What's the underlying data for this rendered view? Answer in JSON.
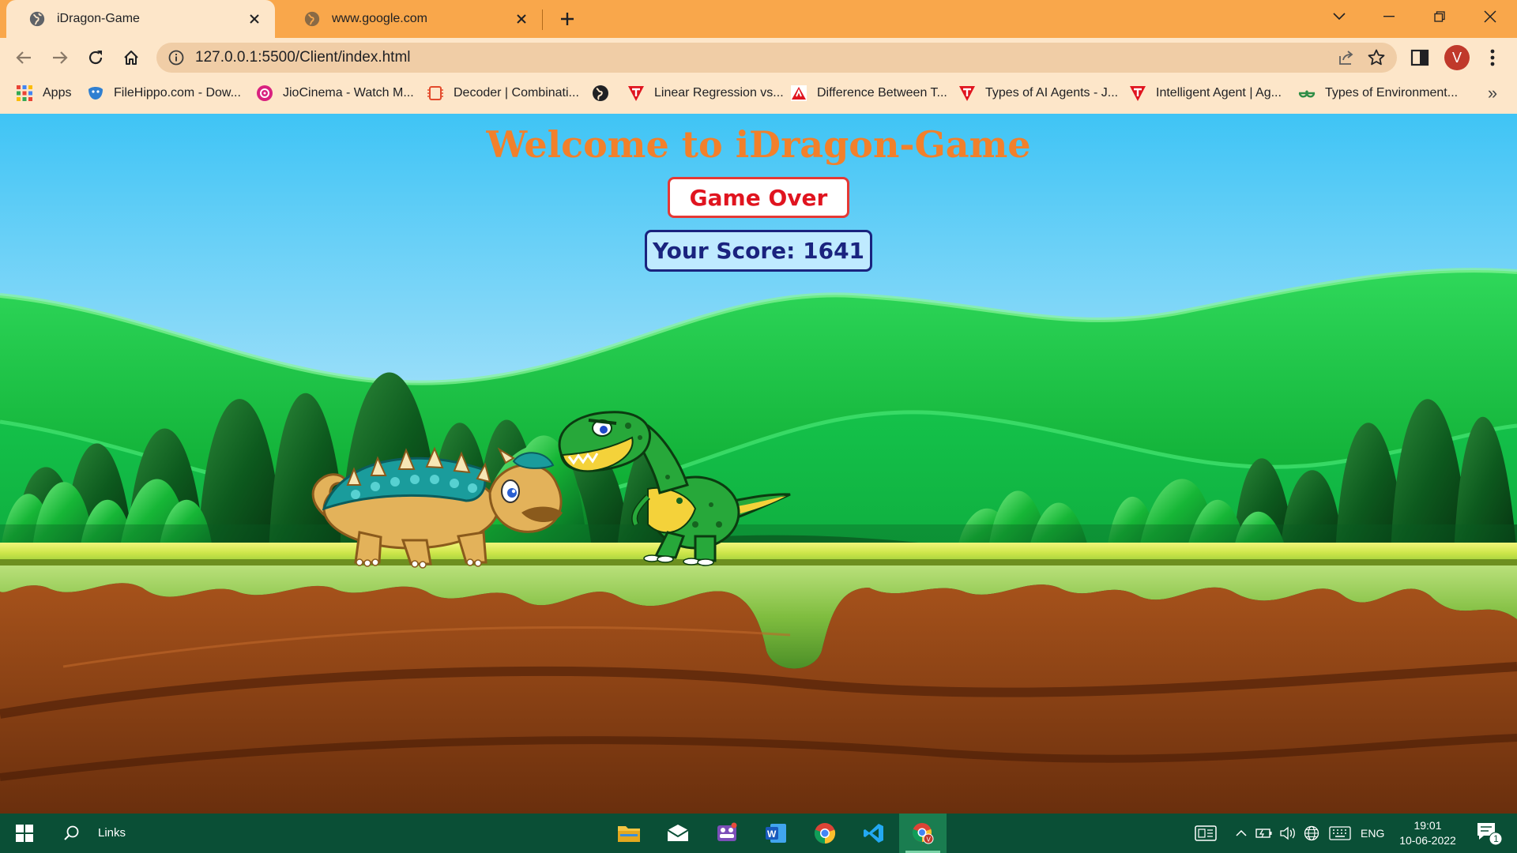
{
  "browser": {
    "tabs": [
      {
        "title": "iDragon-Game",
        "active": true
      },
      {
        "title": "www.google.com",
        "active": false
      }
    ],
    "url": "127.0.0.1:5500/Client/index.html",
    "profile_initial": "V",
    "colors": {
      "frame": "#f9a74b",
      "toolbar": "#fde6c9",
      "omnibox": "#f0cda6"
    }
  },
  "bookmarks": [
    {
      "label": "Apps",
      "icon": "apps-grid-icon"
    },
    {
      "label": "FileHippo.com - Dow...",
      "icon": "filehippo-icon"
    },
    {
      "label": "JioCinema - Watch M...",
      "icon": "jiocinema-icon"
    },
    {
      "label": "Decoder | Combinati...",
      "icon": "decoder-icon"
    },
    {
      "label": "",
      "icon": "globe-icon"
    },
    {
      "label": "Linear Regression vs...",
      "icon": "tutorial-red-icon"
    },
    {
      "label": "Difference Between T...",
      "icon": "alert-red-icon"
    },
    {
      "label": "Types of AI Agents - J...",
      "icon": "tutorial-red-icon"
    },
    {
      "label": "Intelligent Agent | Ag...",
      "icon": "tutorial-red-icon"
    },
    {
      "label": "Types of Environment...",
      "icon": "geeks-green-icon"
    }
  ],
  "game": {
    "title": "Welcome to iDragon-Game",
    "status": "Game Over",
    "score_text": "Your Score: 1641",
    "colors": {
      "title": "#f2802b",
      "status": "#e0141f",
      "score": "#1a237e"
    }
  },
  "taskbar": {
    "search_label": "Links",
    "apps": [
      "file-explorer-icon",
      "mail-icon",
      "teams-icon",
      "word-icon",
      "chrome-icon",
      "vscode-icon",
      "chrome-profile-icon"
    ],
    "language": "ENG",
    "time": "19:01",
    "date": "10-06-2022",
    "notification_count": "1"
  }
}
